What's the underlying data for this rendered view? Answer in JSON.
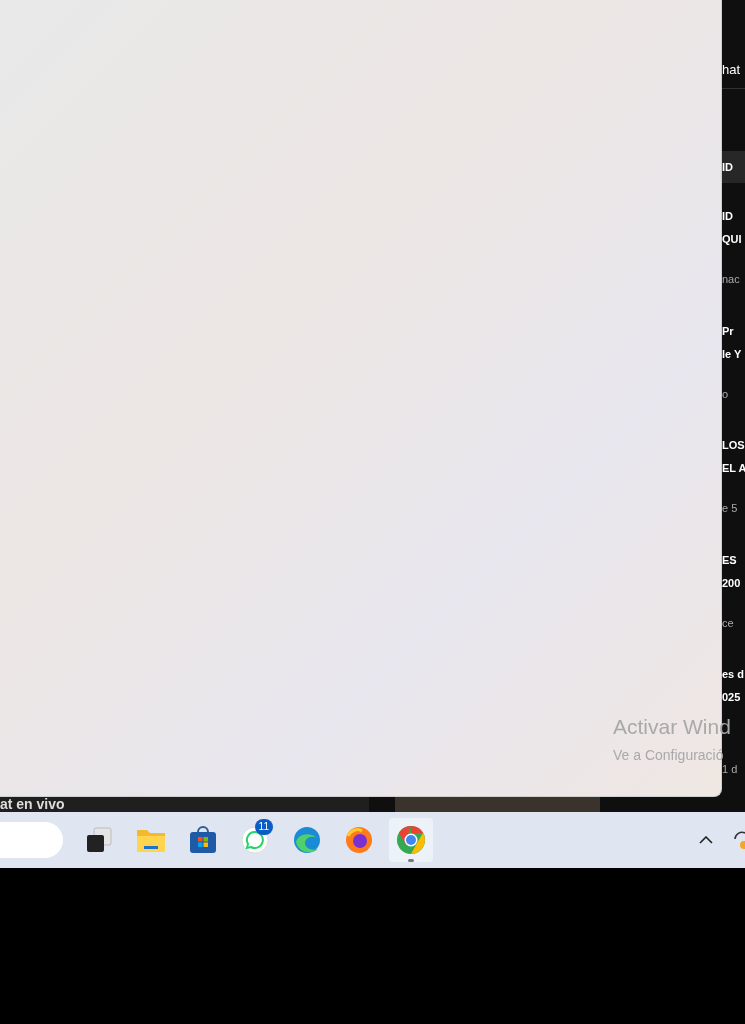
{
  "side_list": {
    "header": "hat",
    "chip": "ID",
    "items": [
      {
        "title": [
          "ID",
          "QUI"
        ],
        "meta": "nac"
      },
      {
        "title": [
          "Pr",
          "le Y"
        ],
        "meta": "o"
      },
      {
        "title": [
          "LOS",
          "EL A"
        ],
        "meta": "e 5"
      },
      {
        "title": [
          "ES",
          "200"
        ],
        "meta": "ce"
      },
      {
        "title": [
          "es d",
          "025"
        ],
        "meta": "1 d"
      }
    ]
  },
  "below_panel": {
    "label": "at en vivo"
  },
  "activation_notice": {
    "title": "Activar Wind",
    "subtitle": "Ve a Configuració"
  },
  "taskbar": {
    "apps": [
      {
        "kind": "task-view",
        "running": false
      },
      {
        "kind": "folder",
        "running": false
      },
      {
        "kind": "store",
        "running": false
      },
      {
        "kind": "chat",
        "running": false,
        "badge": "11"
      },
      {
        "kind": "edge",
        "running": false
      },
      {
        "kind": "firefox",
        "running": false
      },
      {
        "kind": "chrome",
        "running": true
      }
    ]
  }
}
